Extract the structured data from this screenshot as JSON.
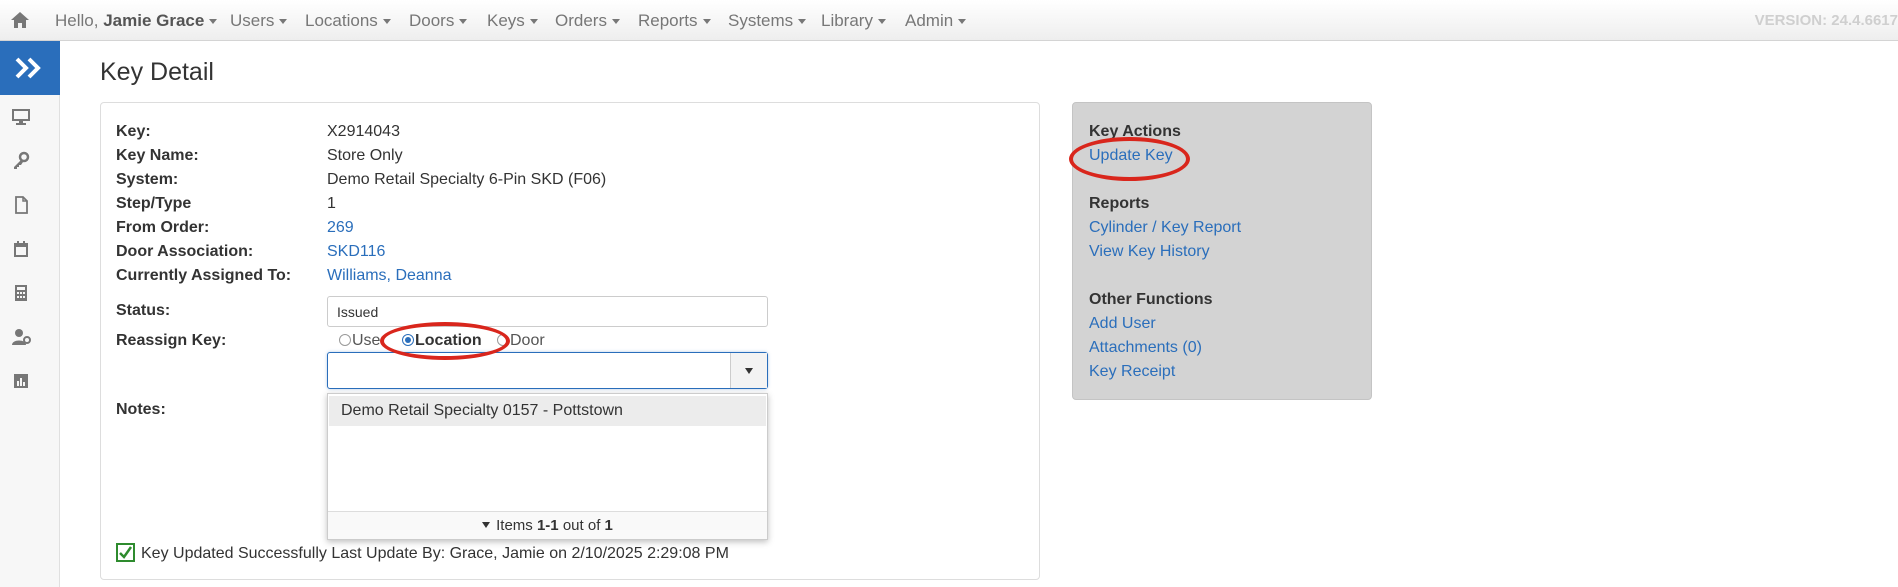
{
  "nav": {
    "hello_prefix": "Hello,",
    "user_name": "Jamie Grace",
    "menus": [
      "Users",
      "Locations",
      "Doors",
      "Keys",
      "Orders",
      "Reports",
      "Systems",
      "Library",
      "Admin"
    ],
    "version": "VERSION: 24.4.6617"
  },
  "sidebar": {
    "icons": [
      "chevron-double-right-icon",
      "monitor-icon",
      "key-icon",
      "document-icon",
      "calendar-icon",
      "calculator-icon",
      "user-gear-icon",
      "bar-chart-icon"
    ]
  },
  "page": {
    "title": "Key Detail"
  },
  "details": {
    "labels": {
      "key": "Key:",
      "key_name": "Key Name:",
      "system": "System:",
      "step_type": "Step/Type",
      "from_order": "From Order:",
      "door_association": "Door Association:",
      "assigned_to": "Currently Assigned To:",
      "status": "Status:",
      "reassign": "Reassign Key:",
      "notes": "Notes:"
    },
    "values": {
      "key": "X2914043",
      "key_name": "Store Only",
      "system": "Demo Retail Specialty 6-Pin SKD (F06)",
      "step_type": "1",
      "from_order": "269",
      "door_association": "SKD116",
      "assigned_to": "Williams, Deanna",
      "status": "Issued"
    },
    "reassign_options": {
      "user": "User",
      "location": "Location",
      "door": "Door",
      "selected": "Location"
    },
    "combo_value": "",
    "dropdown": {
      "items": [
        "Demo Retail Specialty 0157 - Pottstown"
      ],
      "footer_prefix": "Items",
      "footer_range": "1-1",
      "footer_mid": "out of",
      "footer_total": "1"
    },
    "success_message": "Key Updated Successfully Last Update By: Grace, Jamie on 2/10/2025 2:29:08 PM"
  },
  "actions": {
    "key_actions_heading": "Key Actions",
    "update_key": "Update Key",
    "reports_heading": "Reports",
    "cylinder_key_report": "Cylinder / Key Report",
    "view_key_history": "View Key History",
    "other_heading": "Other Functions",
    "add_user": "Add User",
    "attachments": "Attachments (0)",
    "key_receipt": "Key Receipt"
  },
  "colors": {
    "link": "#2a6ebb",
    "sidebar_accent": "#2a6ebb",
    "annotation_ring": "#d9261c",
    "actions_panel": "#d3d3d3"
  }
}
